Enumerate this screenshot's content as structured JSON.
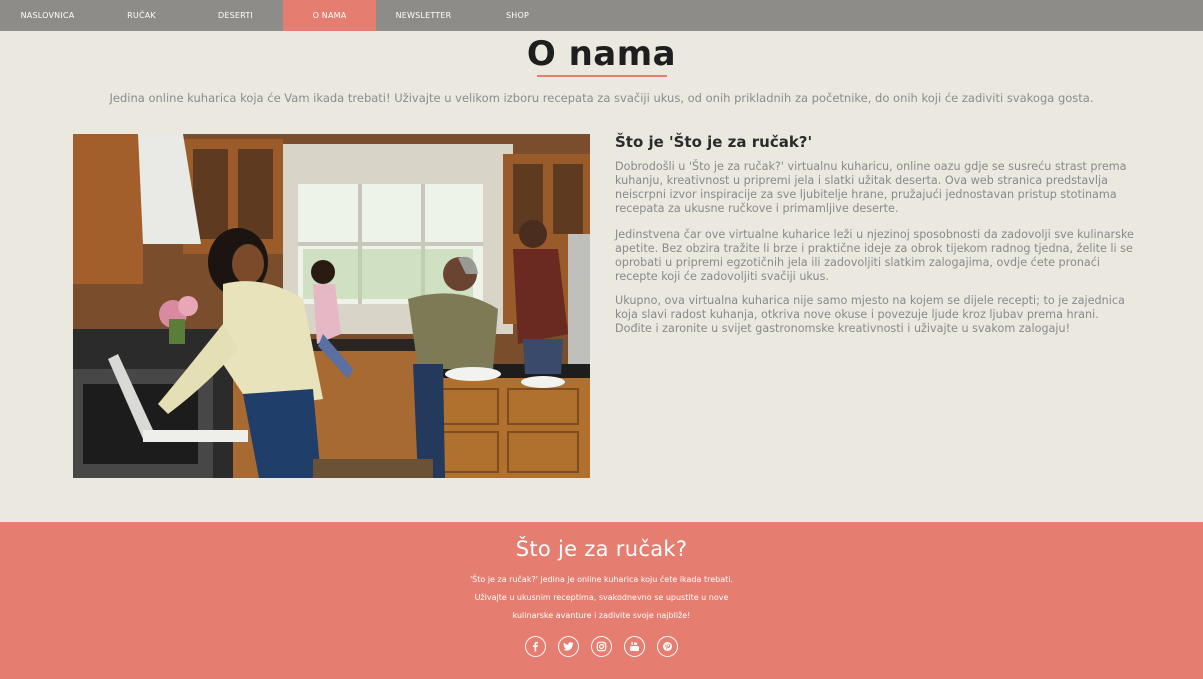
{
  "nav": {
    "items": [
      {
        "label": "NASLOVNICA"
      },
      {
        "label": "RUČAK"
      },
      {
        "label": "DESERTI"
      },
      {
        "label": "O NAMA"
      },
      {
        "label": "NEWSLETTER"
      },
      {
        "label": "SHOP"
      }
    ],
    "active_color": "#e57d70",
    "background": "#8e8c88"
  },
  "header": {
    "title": "O nama",
    "intro": "Jedina online kuharica koja će Vam ikada trebati! Uživajte u velikom izboru recepata za svačiji ukus, od onih prikladnih za početnike, do onih koji će zadiviti svakoga gosta."
  },
  "about": {
    "heading": "Što je 'Što je za ručak?'",
    "paragraphs": [
      "Dobrodošli u 'Što je za ručak?' virtualnu kuharicu, online oazu gdje se susreću strast prema kuhanju, kreativnost u pripremi jela i slatki užitak deserta. Ova web stranica predstavlja neiscrpni izvor inspiracije za sve ljubitelje hrane, pružajući jednostavan pristup stotinama recepata za ukusne ručkove i primamljive deserte.",
      "Jedinstvena čar ove virtualne kuharice leži u njezinoj sposobnosti da zadovolji sve kulinarske apetite. Bez obzira tražite li brze i praktične ideje za obrok tijekom radnog tjedna, želite li se oprobati u pripremi egzotičnih jela ili zadovoljiti slatkim zalogajima, ovdje ćete pronaći recepte koji će zadovoljiti svačiji ukus.",
      "Ukupno, ova virtualna kuharica nije samo mjesto na kojem se dijele recepti; to je zajednica koja slavi radost kuhanja, otkriva nove okuse i povezuje ljude kroz ljubav prema hrani. Dođite i zaronite u svijet gastronomske kreativnosti i uživajte u svakom zalogaju!"
    ]
  },
  "footer": {
    "title": "Što je za ručak?",
    "lines": [
      "'Što je za ručak?' jedina je online kuharica koju ćete ikada trebati.",
      "Uživajte u ukusnim receptima, svakodnevno se upustite u nove",
      "kulinarske avanture i zadivite svoje najbliže!"
    ],
    "socials": [
      "facebook-icon",
      "twitter-icon",
      "instagram-icon",
      "youtube-icon",
      "pinterest-icon"
    ],
    "background": "#e57d70"
  }
}
